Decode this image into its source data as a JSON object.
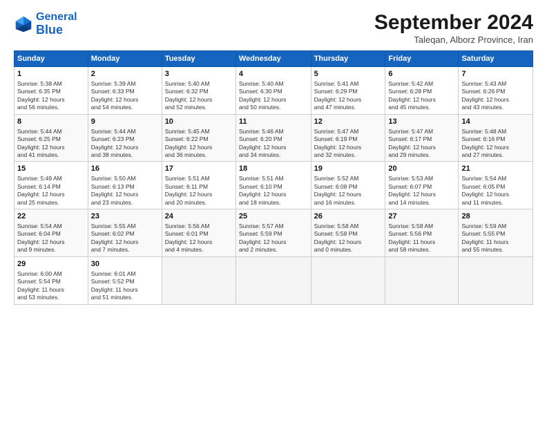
{
  "header": {
    "logo_general": "General",
    "logo_blue": "Blue",
    "month_title": "September 2024",
    "location": "Taleqan, Alborz Province, Iran"
  },
  "weekdays": [
    "Sunday",
    "Monday",
    "Tuesday",
    "Wednesday",
    "Thursday",
    "Friday",
    "Saturday"
  ],
  "weeks": [
    [
      {
        "day": "1",
        "detail": "Sunrise: 5:38 AM\nSunset: 6:35 PM\nDaylight: 12 hours\nand 56 minutes."
      },
      {
        "day": "2",
        "detail": "Sunrise: 5:39 AM\nSunset: 6:33 PM\nDaylight: 12 hours\nand 54 minutes."
      },
      {
        "day": "3",
        "detail": "Sunrise: 5:40 AM\nSunset: 6:32 PM\nDaylight: 12 hours\nand 52 minutes."
      },
      {
        "day": "4",
        "detail": "Sunrise: 5:40 AM\nSunset: 6:30 PM\nDaylight: 12 hours\nand 50 minutes."
      },
      {
        "day": "5",
        "detail": "Sunrise: 5:41 AM\nSunset: 6:29 PM\nDaylight: 12 hours\nand 47 minutes."
      },
      {
        "day": "6",
        "detail": "Sunrise: 5:42 AM\nSunset: 6:28 PM\nDaylight: 12 hours\nand 45 minutes."
      },
      {
        "day": "7",
        "detail": "Sunrise: 5:43 AM\nSunset: 6:26 PM\nDaylight: 12 hours\nand 43 minutes."
      }
    ],
    [
      {
        "day": "8",
        "detail": "Sunrise: 5:44 AM\nSunset: 6:25 PM\nDaylight: 12 hours\nand 41 minutes."
      },
      {
        "day": "9",
        "detail": "Sunrise: 5:44 AM\nSunset: 6:23 PM\nDaylight: 12 hours\nand 38 minutes."
      },
      {
        "day": "10",
        "detail": "Sunrise: 5:45 AM\nSunset: 6:22 PM\nDaylight: 12 hours\nand 36 minutes."
      },
      {
        "day": "11",
        "detail": "Sunrise: 5:46 AM\nSunset: 6:20 PM\nDaylight: 12 hours\nand 34 minutes."
      },
      {
        "day": "12",
        "detail": "Sunrise: 5:47 AM\nSunset: 6:19 PM\nDaylight: 12 hours\nand 32 minutes."
      },
      {
        "day": "13",
        "detail": "Sunrise: 5:47 AM\nSunset: 6:17 PM\nDaylight: 12 hours\nand 29 minutes."
      },
      {
        "day": "14",
        "detail": "Sunrise: 5:48 AM\nSunset: 6:16 PM\nDaylight: 12 hours\nand 27 minutes."
      }
    ],
    [
      {
        "day": "15",
        "detail": "Sunrise: 5:49 AM\nSunset: 6:14 PM\nDaylight: 12 hours\nand 25 minutes."
      },
      {
        "day": "16",
        "detail": "Sunrise: 5:50 AM\nSunset: 6:13 PM\nDaylight: 12 hours\nand 23 minutes."
      },
      {
        "day": "17",
        "detail": "Sunrise: 5:51 AM\nSunset: 6:11 PM\nDaylight: 12 hours\nand 20 minutes."
      },
      {
        "day": "18",
        "detail": "Sunrise: 5:51 AM\nSunset: 6:10 PM\nDaylight: 12 hours\nand 18 minutes."
      },
      {
        "day": "19",
        "detail": "Sunrise: 5:52 AM\nSunset: 6:08 PM\nDaylight: 12 hours\nand 16 minutes."
      },
      {
        "day": "20",
        "detail": "Sunrise: 5:53 AM\nSunset: 6:07 PM\nDaylight: 12 hours\nand 14 minutes."
      },
      {
        "day": "21",
        "detail": "Sunrise: 5:54 AM\nSunset: 6:05 PM\nDaylight: 12 hours\nand 11 minutes."
      }
    ],
    [
      {
        "day": "22",
        "detail": "Sunrise: 5:54 AM\nSunset: 6:04 PM\nDaylight: 12 hours\nand 9 minutes."
      },
      {
        "day": "23",
        "detail": "Sunrise: 5:55 AM\nSunset: 6:02 PM\nDaylight: 12 hours\nand 7 minutes."
      },
      {
        "day": "24",
        "detail": "Sunrise: 5:56 AM\nSunset: 6:01 PM\nDaylight: 12 hours\nand 4 minutes."
      },
      {
        "day": "25",
        "detail": "Sunrise: 5:57 AM\nSunset: 5:59 PM\nDaylight: 12 hours\nand 2 minutes."
      },
      {
        "day": "26",
        "detail": "Sunrise: 5:58 AM\nSunset: 5:58 PM\nDaylight: 12 hours\nand 0 minutes."
      },
      {
        "day": "27",
        "detail": "Sunrise: 5:58 AM\nSunset: 5:56 PM\nDaylight: 11 hours\nand 58 minutes."
      },
      {
        "day": "28",
        "detail": "Sunrise: 5:59 AM\nSunset: 5:55 PM\nDaylight: 11 hours\nand 55 minutes."
      }
    ],
    [
      {
        "day": "29",
        "detail": "Sunrise: 6:00 AM\nSunset: 5:54 PM\nDaylight: 11 hours\nand 53 minutes."
      },
      {
        "day": "30",
        "detail": "Sunrise: 6:01 AM\nSunset: 5:52 PM\nDaylight: 11 hours\nand 51 minutes."
      },
      {
        "day": "",
        "detail": ""
      },
      {
        "day": "",
        "detail": ""
      },
      {
        "day": "",
        "detail": ""
      },
      {
        "day": "",
        "detail": ""
      },
      {
        "day": "",
        "detail": ""
      }
    ]
  ]
}
